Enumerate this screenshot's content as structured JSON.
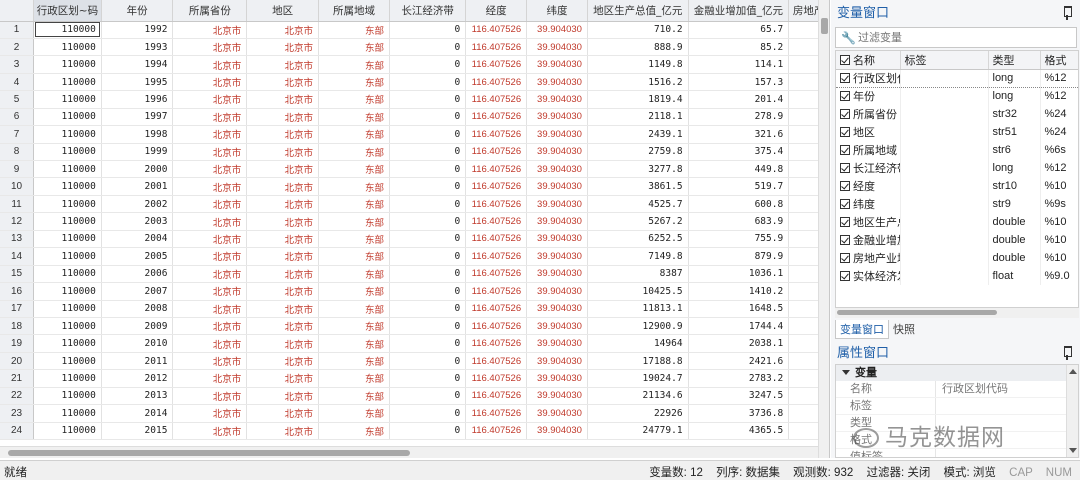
{
  "grid": {
    "row_numbers": [
      "1",
      "2",
      "3",
      "4",
      "5",
      "6",
      "7",
      "8",
      "9",
      "10",
      "11",
      "12",
      "13",
      "14",
      "15",
      "16",
      "17",
      "18",
      "19",
      "20",
      "21",
      "22",
      "23",
      "24"
    ],
    "headers": [
      "行政区划~码",
      "年份",
      "所属省份",
      "地区",
      "所属地域",
      "长江经济带",
      "经度",
      "纬度",
      "地区生产总值_亿元",
      "金融业增加值_亿元",
      "房地产"
    ],
    "region_code": "110000",
    "province": "北京市",
    "city": "北京市",
    "area": "东部",
    "yangtze": "0",
    "longitude": "116.407526",
    "latitude": "39.904030",
    "rows": [
      {
        "year": "1992",
        "gdp": "710.2",
        "fin": "65.7"
      },
      {
        "year": "1993",
        "gdp": "888.9",
        "fin": "85.2"
      },
      {
        "year": "1994",
        "gdp": "1149.8",
        "fin": "114.1"
      },
      {
        "year": "1995",
        "gdp": "1516.2",
        "fin": "157.3"
      },
      {
        "year": "1996",
        "gdp": "1819.4",
        "fin": "201.4"
      },
      {
        "year": "1997",
        "gdp": "2118.1",
        "fin": "278.9"
      },
      {
        "year": "1998",
        "gdp": "2439.1",
        "fin": "321.6"
      },
      {
        "year": "1999",
        "gdp": "2759.8",
        "fin": "375.4"
      },
      {
        "year": "2000",
        "gdp": "3277.8",
        "fin": "449.8"
      },
      {
        "year": "2001",
        "gdp": "3861.5",
        "fin": "519.7"
      },
      {
        "year": "2002",
        "gdp": "4525.7",
        "fin": "600.8"
      },
      {
        "year": "2003",
        "gdp": "5267.2",
        "fin": "683.9"
      },
      {
        "year": "2004",
        "gdp": "6252.5",
        "fin": "755.9"
      },
      {
        "year": "2005",
        "gdp": "7149.8",
        "fin": "879.9"
      },
      {
        "year": "2006",
        "gdp": "8387",
        "fin": "1036.1"
      },
      {
        "year": "2007",
        "gdp": "10425.5",
        "fin": "1410.2"
      },
      {
        "year": "2008",
        "gdp": "11813.1",
        "fin": "1648.5"
      },
      {
        "year": "2009",
        "gdp": "12900.9",
        "fin": "1744.4"
      },
      {
        "year": "2010",
        "gdp": "14964",
        "fin": "2038.1"
      },
      {
        "year": "2011",
        "gdp": "17188.8",
        "fin": "2421.6"
      },
      {
        "year": "2012",
        "gdp": "19024.7",
        "fin": "2783.2"
      },
      {
        "year": "2013",
        "gdp": "21134.6",
        "fin": "3247.5"
      },
      {
        "year": "2014",
        "gdp": "22926",
        "fin": "3736.8"
      },
      {
        "year": "2015",
        "gdp": "24779.1",
        "fin": "4365.5"
      }
    ]
  },
  "variables_panel": {
    "title": "变量窗口",
    "filter_placeholder": "过滤变量",
    "headers": [
      "名称",
      "标签",
      "类型",
      "格式"
    ],
    "items": [
      {
        "name": "行政区划代...",
        "label": "",
        "type": "long",
        "format": "%12"
      },
      {
        "name": "年份",
        "label": "",
        "type": "long",
        "format": "%12"
      },
      {
        "name": "所属省份",
        "label": "",
        "type": "str32",
        "format": "%24"
      },
      {
        "name": "地区",
        "label": "",
        "type": "str51",
        "format": "%24"
      },
      {
        "name": "所属地域",
        "label": "",
        "type": "str6",
        "format": "%6s"
      },
      {
        "name": "长江经济带",
        "label": "",
        "type": "long",
        "format": "%12"
      },
      {
        "name": "经度",
        "label": "",
        "type": "str10",
        "format": "%10"
      },
      {
        "name": "纬度",
        "label": "",
        "type": "str9",
        "format": "%9s"
      },
      {
        "name": "地区生产总...",
        "label": "",
        "type": "double",
        "format": "%10"
      },
      {
        "name": "金融业增加...",
        "label": "",
        "type": "double",
        "format": "%10"
      },
      {
        "name": "房地产业增...",
        "label": "",
        "type": "double",
        "format": "%10"
      },
      {
        "name": "实体经济发...",
        "label": "",
        "type": "float",
        "format": "%9.0"
      }
    ],
    "tabs": [
      "变量窗口",
      "快照"
    ]
  },
  "properties_panel": {
    "title": "属性窗口",
    "group": "变量",
    "rows": [
      {
        "key": "名称",
        "value": "行政区划代码"
      },
      {
        "key": "标签",
        "value": ""
      },
      {
        "key": "类型",
        "value": ""
      },
      {
        "key": "格式",
        "value": ""
      },
      {
        "key": "值标签",
        "value": ""
      }
    ]
  },
  "watermark": "马克数据网",
  "status": {
    "ready": "就绪",
    "var_count": "变量数: 12",
    "order": "列序: 数据集",
    "obs": "观测数: 932",
    "filter": "过滤器: 关闭",
    "mode": "模式: 浏览",
    "cap": "CAP",
    "num": "NUM"
  },
  "colors": {
    "string_value": "#c0392b",
    "panel_title": "#1f5fa8",
    "header_bg": "#eef0f3"
  }
}
